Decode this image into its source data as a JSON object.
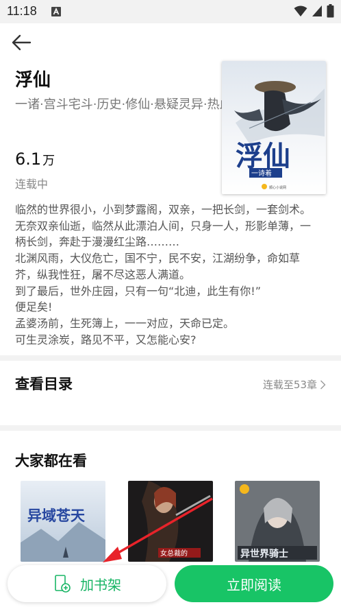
{
  "status_bar": {
    "time": "11:18"
  },
  "book": {
    "title": "浮仙",
    "tags": "一诸·宫斗宅斗·历史·修仙·悬疑灵异·热血",
    "word_count": "6.1",
    "word_unit": "万",
    "status": "连载中",
    "cover_title": "浮仙",
    "cover_author": "一诗着",
    "cover_publisher": "顺心小说网",
    "intro_lines": [
      "临然的世界很小，小到梦露阁，双亲，一把长剑，一套剑术。",
      "无奈双亲仙逝，临然从此漂泊人间，只身一人，形影单薄，一",
      "柄长剑，奔赴于漫漫红尘路………",
      "北渊风雨，大仪危亡，国不宁，民不安，江湖纷争，命如草",
      "芥，纵我性狂，屠不尽这恶人满道。",
      "到了最后，世外庄园，只有一句“北迪，此生有你!”",
      "便足矣!",
      "孟婆汤前，生死簿上，一一对应，天命已定。",
      "可生灵涂炭，路见不平，又怎能心安?"
    ]
  },
  "toc": {
    "heading": "查看目录",
    "chapter_status": "连载至53章"
  },
  "recommend": {
    "heading": "大家都在看",
    "books": [
      {
        "cover_text": "异域苍天"
      },
      {
        "cover_text": "女总裁的"
      },
      {
        "cover_text": "异世界骑士"
      }
    ]
  },
  "actions": {
    "add_shelf_label": "加书架",
    "read_label": "立即阅读"
  },
  "colors": {
    "accent": "#18c466",
    "accent_text": "#18b565",
    "annotation_arrow": "#e8232a"
  }
}
